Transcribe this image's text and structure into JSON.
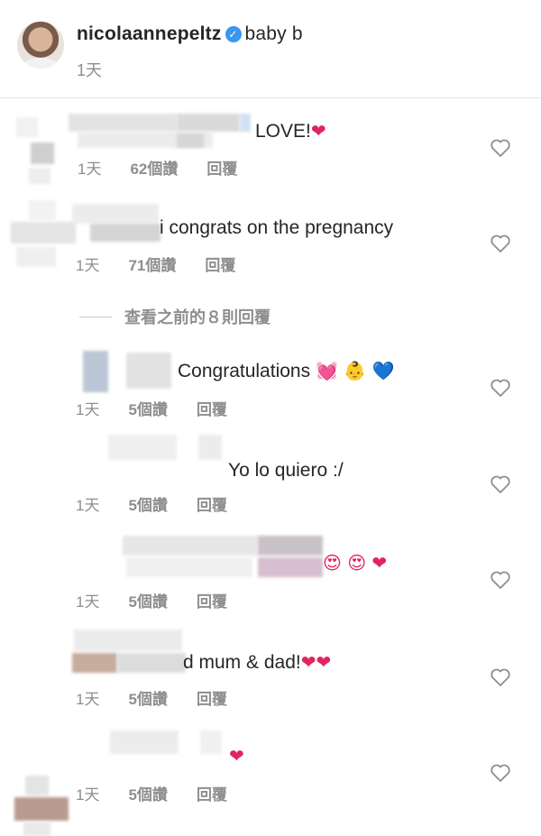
{
  "post": {
    "username": "nicolaannepeltz",
    "caption": "baby b",
    "time": "1天"
  },
  "comments": [
    {
      "text": "LOVE!",
      "emoji": "❤",
      "time": "1天",
      "likes": "62個讚",
      "reply": "回覆"
    },
    {
      "text": "i congrats on the pregnancy",
      "emoji": "",
      "time": "1天",
      "likes": "71個讚",
      "reply": "回覆"
    },
    {
      "text": "Congratulations",
      "emoji": "💓 👶 💙",
      "time": "1天",
      "likes": "5個讚",
      "reply": "回覆"
    },
    {
      "text": "Yo lo quiero :/",
      "emoji": "",
      "time": "1天",
      "likes": "5個讚",
      "reply": "回覆"
    },
    {
      "text": "",
      "emoji": "😍 😍 ❤",
      "time": "1天",
      "likes": "5個讚",
      "reply": "回覆"
    },
    {
      "text": "d mum & dad!",
      "emoji": "❤❤",
      "time": "1天",
      "likes": "5個讚",
      "reply": "回覆"
    },
    {
      "text": "",
      "emoji": "❤",
      "time": "1天",
      "likes": "5個讚",
      "reply": "回覆"
    }
  ],
  "view_previous_replies": "查看之前的８則回覆",
  "icons": {
    "verified": "verified-badge-icon",
    "like": "heart-outline-icon"
  },
  "colors": {
    "text": "#262626",
    "secondary": "#8e8e8e",
    "verified": "#3897f0",
    "heart": "#e0245e"
  }
}
